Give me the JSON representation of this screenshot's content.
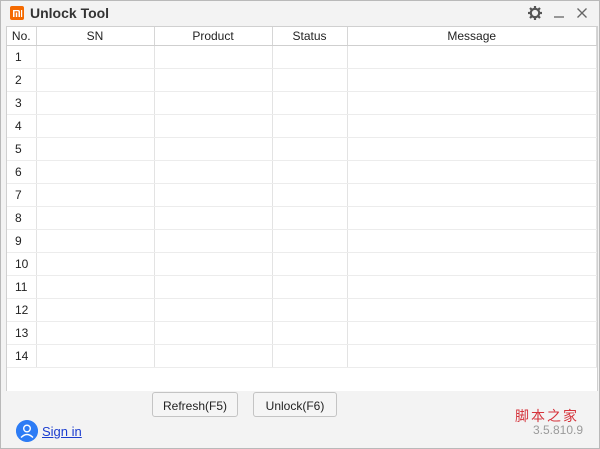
{
  "window": {
    "title": "Unlock Tool"
  },
  "icons": {
    "logo": "mi-logo",
    "settings": "gear-icon",
    "minimize": "minimize-icon",
    "close": "close-icon",
    "avatar": "user-icon"
  },
  "table": {
    "columns": [
      "No.",
      "SN",
      "Product",
      "Status",
      "Message"
    ],
    "rows": [
      {
        "no": "1",
        "sn": "",
        "product": "",
        "status": "",
        "message": ""
      },
      {
        "no": "2",
        "sn": "",
        "product": "",
        "status": "",
        "message": ""
      },
      {
        "no": "3",
        "sn": "",
        "product": "",
        "status": "",
        "message": ""
      },
      {
        "no": "4",
        "sn": "",
        "product": "",
        "status": "",
        "message": ""
      },
      {
        "no": "5",
        "sn": "",
        "product": "",
        "status": "",
        "message": ""
      },
      {
        "no": "6",
        "sn": "",
        "product": "",
        "status": "",
        "message": ""
      },
      {
        "no": "7",
        "sn": "",
        "product": "",
        "status": "",
        "message": ""
      },
      {
        "no": "8",
        "sn": "",
        "product": "",
        "status": "",
        "message": ""
      },
      {
        "no": "9",
        "sn": "",
        "product": "",
        "status": "",
        "message": ""
      },
      {
        "no": "10",
        "sn": "",
        "product": "",
        "status": "",
        "message": ""
      },
      {
        "no": "11",
        "sn": "",
        "product": "",
        "status": "",
        "message": ""
      },
      {
        "no": "12",
        "sn": "",
        "product": "",
        "status": "",
        "message": ""
      },
      {
        "no": "13",
        "sn": "",
        "product": "",
        "status": "",
        "message": ""
      },
      {
        "no": "14",
        "sn": "",
        "product": "",
        "status": "",
        "message": ""
      }
    ]
  },
  "buttons": {
    "refresh": "Refresh(F5)",
    "unlock": "Unlock(F6)"
  },
  "footer": {
    "sign_in": "Sign in",
    "version": "3.5.810.9",
    "watermark": "脚本之家"
  },
  "colors": {
    "accent": "#f56a00",
    "link": "#1a3ccf",
    "avatar": "#2d7cf5"
  }
}
